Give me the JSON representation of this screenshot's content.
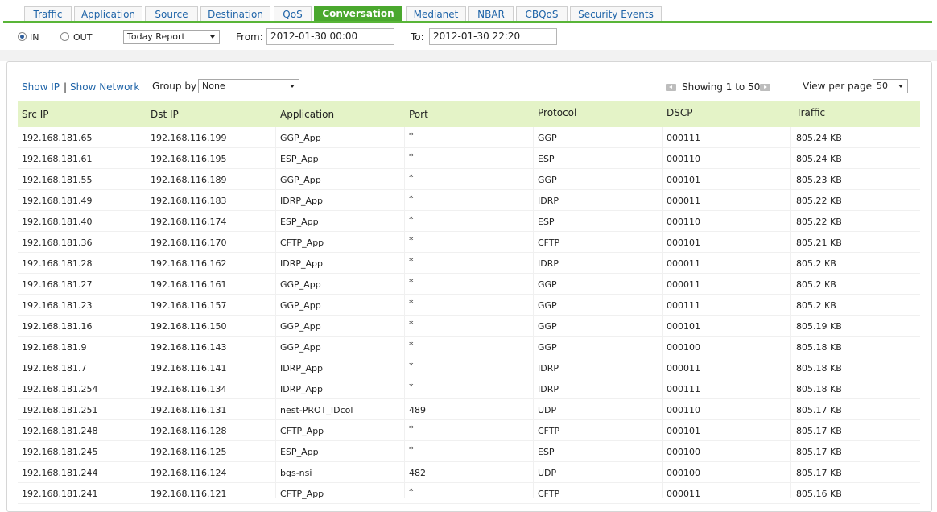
{
  "tabs": [
    "Traffic",
    "Application",
    "Source",
    "Destination",
    "QoS",
    "Conversation",
    "Medianet",
    "NBAR",
    "CBQoS",
    "Security Events"
  ],
  "active_tab": "Conversation",
  "filter": {
    "in_label": "IN",
    "out_label": "OUT",
    "direction_selected": "IN",
    "report_select": "Today Report",
    "from_label": "From:",
    "from_value": "2012-01-30 00:00",
    "to_label": "To:",
    "to_value": "2012-01-30 22:20"
  },
  "toolbar": {
    "show_ip": "Show IP",
    "separator": "|",
    "show_network": "Show Network",
    "group_by_label": "Group by",
    "group_by_value": "None",
    "showing_text": "Showing 1 to 50",
    "view_per_page_label": "View per page",
    "view_per_page_value": "50"
  },
  "columns": [
    "Src IP",
    "Dst IP",
    "Application",
    "Port",
    "Protocol",
    "DSCP",
    "Traffic"
  ],
  "rows": [
    [
      "192.168.181.65",
      "192.168.116.199",
      "GGP_App",
      "*",
      "GGP",
      "000111",
      "805.24 KB"
    ],
    [
      "192.168.181.61",
      "192.168.116.195",
      "ESP_App",
      "*",
      "ESP",
      "000110",
      "805.24 KB"
    ],
    [
      "192.168.181.55",
      "192.168.116.189",
      "GGP_App",
      "*",
      "GGP",
      "000101",
      "805.23 KB"
    ],
    [
      "192.168.181.49",
      "192.168.116.183",
      "IDRP_App",
      "*",
      "IDRP",
      "000011",
      "805.22 KB"
    ],
    [
      "192.168.181.40",
      "192.168.116.174",
      "ESP_App",
      "*",
      "ESP",
      "000110",
      "805.22 KB"
    ],
    [
      "192.168.181.36",
      "192.168.116.170",
      "CFTP_App",
      "*",
      "CFTP",
      "000101",
      "805.21 KB"
    ],
    [
      "192.168.181.28",
      "192.168.116.162",
      "IDRP_App",
      "*",
      "IDRP",
      "000011",
      "805.2 KB"
    ],
    [
      "192.168.181.27",
      "192.168.116.161",
      "GGP_App",
      "*",
      "GGP",
      "000011",
      "805.2 KB"
    ],
    [
      "192.168.181.23",
      "192.168.116.157",
      "GGP_App",
      "*",
      "GGP",
      "000111",
      "805.2 KB"
    ],
    [
      "192.168.181.16",
      "192.168.116.150",
      "GGP_App",
      "*",
      "GGP",
      "000101",
      "805.19 KB"
    ],
    [
      "192.168.181.9",
      "192.168.116.143",
      "GGP_App",
      "*",
      "GGP",
      "000100",
      "805.18 KB"
    ],
    [
      "192.168.181.7",
      "192.168.116.141",
      "IDRP_App",
      "*",
      "IDRP",
      "000011",
      "805.18 KB"
    ],
    [
      "192.168.181.254",
      "192.168.116.134",
      "IDRP_App",
      "*",
      "IDRP",
      "000111",
      "805.18 KB"
    ],
    [
      "192.168.181.251",
      "192.168.116.131",
      "nest-PROT_IDcol",
      "489",
      "UDP",
      "000110",
      "805.17 KB"
    ],
    [
      "192.168.181.248",
      "192.168.116.128",
      "CFTP_App",
      "*",
      "CFTP",
      "000101",
      "805.17 KB"
    ],
    [
      "192.168.181.245",
      "192.168.116.125",
      "ESP_App",
      "*",
      "ESP",
      "000100",
      "805.17 KB"
    ],
    [
      "192.168.181.244",
      "192.168.116.124",
      "bgs-nsi",
      "482",
      "UDP",
      "000100",
      "805.17 KB"
    ],
    [
      "192.168.181.241",
      "192.168.116.121",
      "CFTP_App",
      "*",
      "CFTP",
      "000011",
      "805.16 KB"
    ]
  ],
  "colors": {
    "accent": "#4aa82e",
    "header_bg": "#e4f3c7",
    "link": "#1f64a8"
  }
}
